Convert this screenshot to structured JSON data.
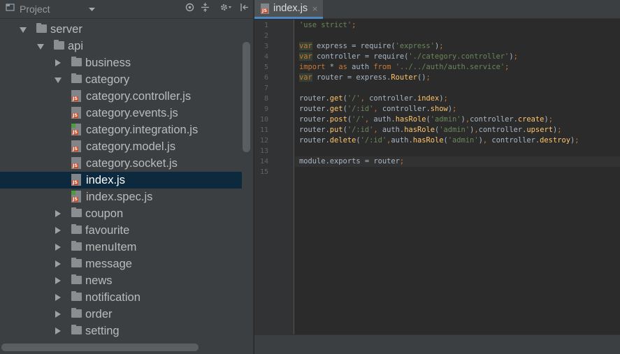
{
  "project_panel": {
    "title": "Project",
    "icons": [
      "project-icon",
      "dropdown-arrow-icon",
      "sync-target-icon",
      "collapse-all-icon",
      "settings-icon",
      "hide-panel-icon"
    ],
    "tree": [
      {
        "label": "server",
        "kind": "folder",
        "depth": 0,
        "expanded": true
      },
      {
        "label": "api",
        "kind": "folder",
        "depth": 1,
        "expanded": true
      },
      {
        "label": "business",
        "kind": "folder",
        "depth": 2,
        "expanded": false
      },
      {
        "label": "category",
        "kind": "folder",
        "depth": 2,
        "expanded": true
      },
      {
        "label": "category.controller.js",
        "kind": "js",
        "depth": 3
      },
      {
        "label": "category.events.js",
        "kind": "js",
        "depth": 3
      },
      {
        "label": "category.integration.js",
        "kind": "js-test",
        "depth": 3
      },
      {
        "label": "category.model.js",
        "kind": "js",
        "depth": 3
      },
      {
        "label": "category.socket.js",
        "kind": "js",
        "depth": 3
      },
      {
        "label": "index.js",
        "kind": "js",
        "depth": 3,
        "selected": true
      },
      {
        "label": "index.spec.js",
        "kind": "js-test",
        "depth": 3
      },
      {
        "label": "coupon",
        "kind": "folder",
        "depth": 2,
        "expanded": false
      },
      {
        "label": "favourite",
        "kind": "folder",
        "depth": 2,
        "expanded": false
      },
      {
        "label": "menuItem",
        "kind": "folder",
        "depth": 2,
        "expanded": false
      },
      {
        "label": "message",
        "kind": "folder",
        "depth": 2,
        "expanded": false
      },
      {
        "label": "news",
        "kind": "folder",
        "depth": 2,
        "expanded": false
      },
      {
        "label": "notification",
        "kind": "folder",
        "depth": 2,
        "expanded": false
      },
      {
        "label": "order",
        "kind": "folder",
        "depth": 2,
        "expanded": false
      },
      {
        "label": "setting",
        "kind": "folder",
        "depth": 2,
        "expanded": false
      }
    ]
  },
  "editor": {
    "tab": {
      "label": "index.js",
      "close": "×"
    },
    "current_line": 14,
    "lines": [
      [
        [
          "str",
          "'use strict'"
        ],
        [
          "kw",
          ";"
        ]
      ],
      [],
      [
        [
          "var",
          "var"
        ],
        [
          "",
          " express = require("
        ],
        [
          "str",
          "'express'"
        ],
        [
          "",
          ")"
        ],
        [
          "kw",
          ";"
        ]
      ],
      [
        [
          "var",
          "var"
        ],
        [
          "",
          " controller = require("
        ],
        [
          "str",
          "'./category.controller'"
        ],
        [
          "",
          ")"
        ],
        [
          "kw",
          ";"
        ]
      ],
      [
        [
          "kw",
          "import"
        ],
        [
          "",
          " * "
        ],
        [
          "kw",
          "as"
        ],
        [
          "",
          " auth "
        ],
        [
          "kw",
          "from"
        ],
        [
          "",
          " "
        ],
        [
          "str",
          "'../../auth/auth.service'"
        ],
        [
          "kw",
          ";"
        ]
      ],
      [
        [
          "var",
          "var"
        ],
        [
          "",
          " router = express."
        ],
        [
          "fn",
          "Router"
        ],
        [
          "",
          "()"
        ],
        [
          "kw",
          ";"
        ]
      ],
      [],
      [
        [
          "",
          "router."
        ],
        [
          "fn",
          "get"
        ],
        [
          "",
          "("
        ],
        [
          "str",
          "'/'"
        ],
        [
          "kw",
          ","
        ],
        [
          "",
          " controller."
        ],
        [
          "fn",
          "index"
        ],
        [
          "",
          ")"
        ],
        [
          "kw",
          ";"
        ]
      ],
      [
        [
          "",
          "router."
        ],
        [
          "fn",
          "get"
        ],
        [
          "",
          "("
        ],
        [
          "str",
          "'/:id'"
        ],
        [
          "kw",
          ","
        ],
        [
          "",
          " controller."
        ],
        [
          "fn",
          "show"
        ],
        [
          "",
          ")"
        ],
        [
          "kw",
          ";"
        ]
      ],
      [
        [
          "",
          "router."
        ],
        [
          "fn",
          "post"
        ],
        [
          "",
          "("
        ],
        [
          "str",
          "'/'"
        ],
        [
          "kw",
          ","
        ],
        [
          "",
          " auth."
        ],
        [
          "fn",
          "hasRole"
        ],
        [
          "",
          "("
        ],
        [
          "str",
          "'admin'"
        ],
        [
          "",
          ")"
        ],
        [
          "kw",
          ","
        ],
        [
          "",
          "controller."
        ],
        [
          "fn",
          "create"
        ],
        [
          "",
          ")"
        ],
        [
          "kw",
          ";"
        ]
      ],
      [
        [
          "",
          "router."
        ],
        [
          "fn",
          "put"
        ],
        [
          "",
          "("
        ],
        [
          "str",
          "'/:id'"
        ],
        [
          "kw",
          ","
        ],
        [
          "",
          " auth."
        ],
        [
          "fn",
          "hasRole"
        ],
        [
          "",
          "("
        ],
        [
          "str",
          "'admin'"
        ],
        [
          "",
          ")"
        ],
        [
          "kw",
          ","
        ],
        [
          "",
          "controller."
        ],
        [
          "fn",
          "upsert"
        ],
        [
          "",
          ")"
        ],
        [
          "kw",
          ";"
        ]
      ],
      [
        [
          "",
          "router."
        ],
        [
          "fn",
          "delete"
        ],
        [
          "",
          "("
        ],
        [
          "str",
          "'/:id'"
        ],
        [
          "kw",
          ","
        ],
        [
          "",
          "auth."
        ],
        [
          "fn",
          "hasRole"
        ],
        [
          "",
          "("
        ],
        [
          "str",
          "'admin'"
        ],
        [
          "",
          ")"
        ],
        [
          "kw",
          ","
        ],
        [
          "",
          " controller."
        ],
        [
          "fn",
          "destroy"
        ],
        [
          "",
          ")"
        ],
        [
          "kw",
          ";"
        ]
      ],
      [],
      [
        [
          "",
          "module.exports = router"
        ],
        [
          "kw",
          ";"
        ]
      ],
      []
    ]
  }
}
